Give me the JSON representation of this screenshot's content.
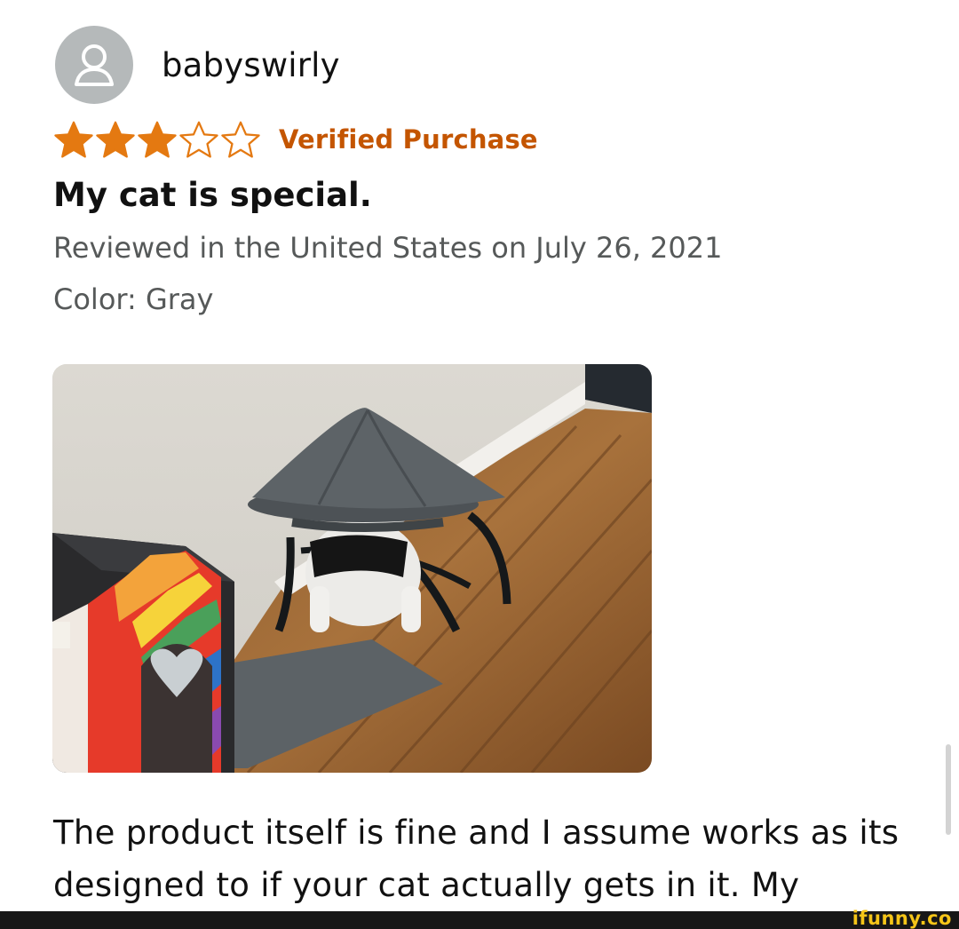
{
  "reviewer": {
    "name": "babyswirly",
    "avatar_icon": "user-silhouette-icon"
  },
  "rating": {
    "value": 3,
    "max": 5,
    "star_color": "#e47911",
    "verified_label": "Verified Purchase",
    "verified_color": "#c45500"
  },
  "review": {
    "title": "My cat is special.",
    "date_line": "Reviewed in the United States on July 26, 2021",
    "color_line": "Color: Gray",
    "photo_icon": "customer-photo-cat-under-elevated-bed",
    "body": "The product itself is fine and I assume works as its designed to if your cat actually gets in it. My"
  },
  "watermark": {
    "text": "ifunny.co"
  }
}
